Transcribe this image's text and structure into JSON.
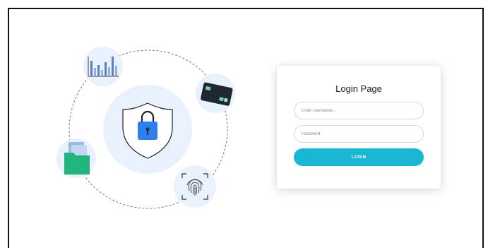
{
  "login": {
    "title": "Login Page",
    "username_placeholder": "Enter Username...",
    "password_placeholder": "Password",
    "button_label": "LOGIN"
  },
  "colors": {
    "accent": "#1ab6d4",
    "illustration_bg": "#e9f1fc",
    "lock_blue": "#2f80ed",
    "folder_green": "#21b57d",
    "card_dark": "#1f2733"
  },
  "illustration": {
    "center_icon": "shield-lock-icon",
    "orbit_icons": [
      "bar-chart-icon",
      "credit-card-icon",
      "folder-icon",
      "fingerprint-icon"
    ]
  }
}
